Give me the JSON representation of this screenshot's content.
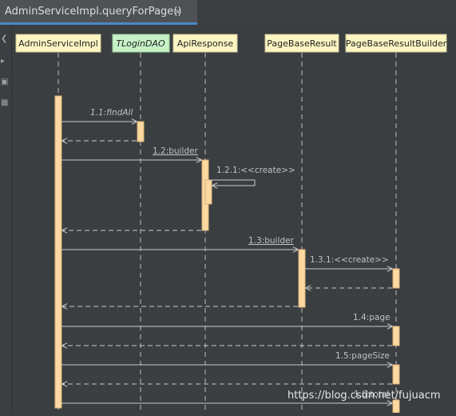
{
  "tab": {
    "title": "AdminServiceImpl.queryForPage()",
    "close_glyph": "×"
  },
  "sidebar": {
    "icons": [
      "collapse-icon",
      "play-icon",
      "export-icon",
      "settings-icon"
    ]
  },
  "participants": [
    {
      "name": "AdminServiceImpl",
      "kind": "class"
    },
    {
      "name": "TLoginDAO",
      "kind": "interface"
    },
    {
      "name": "ApiResponse",
      "kind": "class"
    },
    {
      "name": "PageBaseResult",
      "kind": "class"
    },
    {
      "name": "PageBaseResultBuilder",
      "kind": "class"
    }
  ],
  "messages": [
    {
      "label": "1.1:findAll",
      "italic": true,
      "underline": false
    },
    {
      "label": "1.2:builder",
      "italic": false,
      "underline": true
    },
    {
      "label": "1.2.1:<<create>>",
      "italic": false,
      "underline": false
    },
    {
      "label": "1.3:builder",
      "italic": false,
      "underline": true
    },
    {
      "label": "1.3.1:<<create>>",
      "italic": false,
      "underline": false
    },
    {
      "label": "1.4:page",
      "italic": false,
      "underline": false
    },
    {
      "label": "1.5:pageSize",
      "italic": false,
      "underline": false
    },
    {
      "label": "1.6:total",
      "italic": false,
      "underline": false
    }
  ],
  "watermark": "https://blog.csdn.net/fujuacm",
  "colors": {
    "class_box": "#fdf6c3",
    "interface_box": "#c6f2c6",
    "activation": "#fbd9a0",
    "lines": "#c9c9c9"
  }
}
